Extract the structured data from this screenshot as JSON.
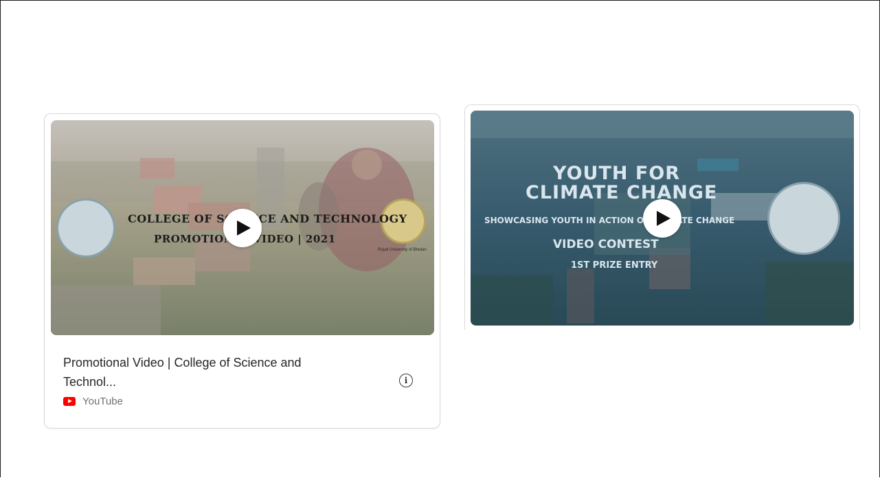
{
  "cards": [
    {
      "overlay_line1": "COLLEGE OF SCIENCE AND TECHNOLOGY",
      "overlay_line2": "PROMOTIONAL VIDEO | 2021",
      "university_caption": "Royal University of Bhutan",
      "title": "Promotional Video | College of Science and Technol...",
      "source": "YouTube",
      "play_icon": "play-icon",
      "info_icon": "info-icon"
    },
    {
      "overlay_line1": "YOUTH FOR",
      "overlay_line2": "CLIMATE CHANGE",
      "overlay_line3": "SHOWCASING YOUTH IN ACTION ON CLIMATE CHANGE",
      "overlay_line4": "VIDEO CONTEST",
      "overlay_line5": "1ST PRIZE ENTRY",
      "play_icon": "play-icon"
    }
  ],
  "colors": {
    "youtube_red": "#ff0000",
    "card_border": "#d9d9d9",
    "title_text": "#262626",
    "source_text": "#707070"
  }
}
